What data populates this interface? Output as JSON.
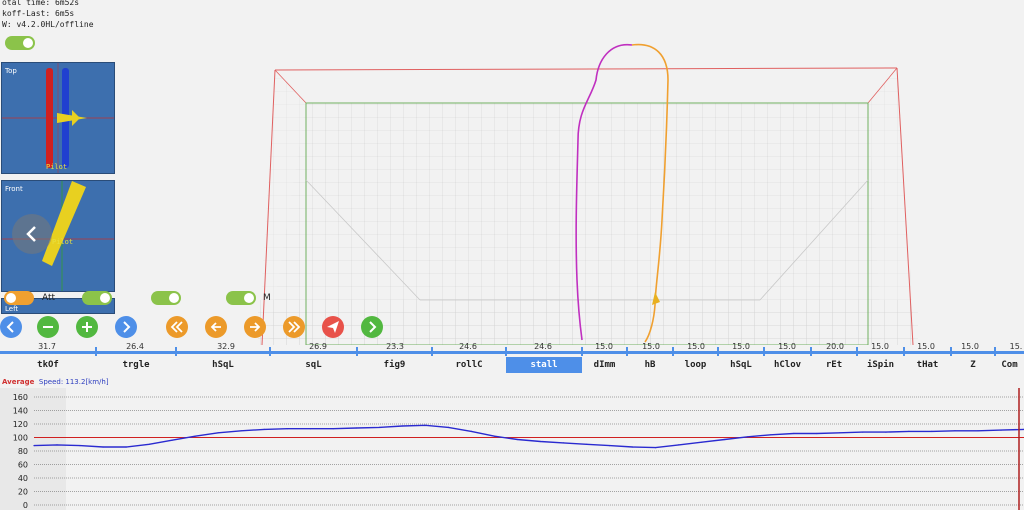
{
  "info": {
    "line1": "otal time: 6m52s",
    "line2": "koff-Last: 6m5s",
    "line3": "W: v4.2.0HL/offline"
  },
  "views": {
    "top_label": "Top",
    "front_label": "Front",
    "left_label": "Left",
    "pilot": "Pilot"
  },
  "toggles": {
    "att_label": "Att",
    "m_label": "M"
  },
  "controls": [
    {
      "name": "prev-icon",
      "color": "blue"
    },
    {
      "name": "minus-icon",
      "color": "green"
    },
    {
      "name": "plus-icon",
      "color": "green"
    },
    {
      "name": "next-icon",
      "color": "blue"
    },
    {
      "name": "rewind-icon",
      "color": "orange"
    },
    {
      "name": "step-back-icon",
      "color": "orange"
    },
    {
      "name": "step-forward-icon",
      "color": "orange"
    },
    {
      "name": "fast-forward-icon",
      "color": "orange"
    },
    {
      "name": "send-icon",
      "color": "red"
    },
    {
      "name": "forward-icon",
      "color": "green"
    }
  ],
  "timeline": {
    "scores": [
      "31.7",
      "26.4",
      "32.9",
      "26.9",
      "23.3",
      "24.6",
      "24.6",
      "15.0",
      "15.0",
      "15.0",
      "15.0",
      "15.0",
      "20.0",
      "15.0",
      "15.0",
      "15.0",
      "15."
    ],
    "maneuvers": [
      "tkOf",
      "trgle",
      "hSqL",
      "sqL",
      "fig9",
      "rollC",
      "stall",
      "dImm",
      "hB",
      "loop",
      "hSqL",
      "hClov",
      "rEt",
      "iSpin",
      "tHat",
      "Z",
      "Com"
    ],
    "selected": "stall"
  },
  "speed_chart": {
    "prefix": "Average",
    "label": "Speed: 113.2[km/h]"
  },
  "chart_data": {
    "type": "line",
    "title": "Speed: 113.2[km/h]",
    "ylim": [
      0,
      160
    ],
    "yticks": [
      "160",
      "140",
      "120",
      "100",
      "80",
      "60",
      "40",
      "20",
      "0"
    ],
    "reference_value": 100,
    "series": [
      {
        "name": "",
        "color": "#2a2ad0",
        "values": [
          88,
          89,
          88,
          86,
          86,
          90,
          96,
          102,
          107,
          110,
          112,
          113,
          113,
          113,
          114,
          115,
          117,
          118,
          115,
          109,
          102,
          97,
          94,
          92,
          90,
          88,
          86,
          85,
          89,
          93,
          97,
          101,
          104,
          106,
          106,
          107,
          108,
          108,
          109,
          109,
          110,
          110,
          111,
          112
        ]
      }
    ],
    "reference_color": "#d02020",
    "grid": true
  }
}
